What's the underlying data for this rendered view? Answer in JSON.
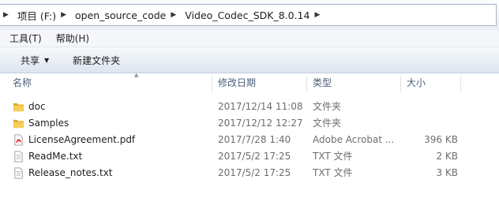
{
  "address": {
    "crumbs": [
      "项目 (F:)",
      "open_source_code",
      "Video_Codec_SDK_8.0.14"
    ]
  },
  "menu": {
    "tools": "工具(T)",
    "help": "帮助(H)"
  },
  "toolbar": {
    "share": "共享",
    "new_folder": "新建文件夹"
  },
  "columns": {
    "name": "名称",
    "date": "修改日期",
    "type": "类型",
    "size": "大小"
  },
  "files": [
    {
      "name": "doc",
      "date": "2017/12/14 11:08",
      "type": "文件夹",
      "size": "",
      "icon": "folder-icon"
    },
    {
      "name": "Samples",
      "date": "2017/12/12 12:27",
      "type": "文件夹",
      "size": "",
      "icon": "folder-icon"
    },
    {
      "name": "LicenseAgreement.pdf",
      "date": "2017/7/28 1:40",
      "type": "Adobe Acrobat ...",
      "size": "396 KB",
      "icon": "pdf-file-icon"
    },
    {
      "name": "ReadMe.txt",
      "date": "2017/5/2 17:25",
      "type": "TXT 文件",
      "size": "2 KB",
      "icon": "text-file-icon"
    },
    {
      "name": "Release_notes.txt",
      "date": "2017/5/2 17:25",
      "type": "TXT 文件",
      "size": "3 KB",
      "icon": "text-file-icon"
    }
  ]
}
